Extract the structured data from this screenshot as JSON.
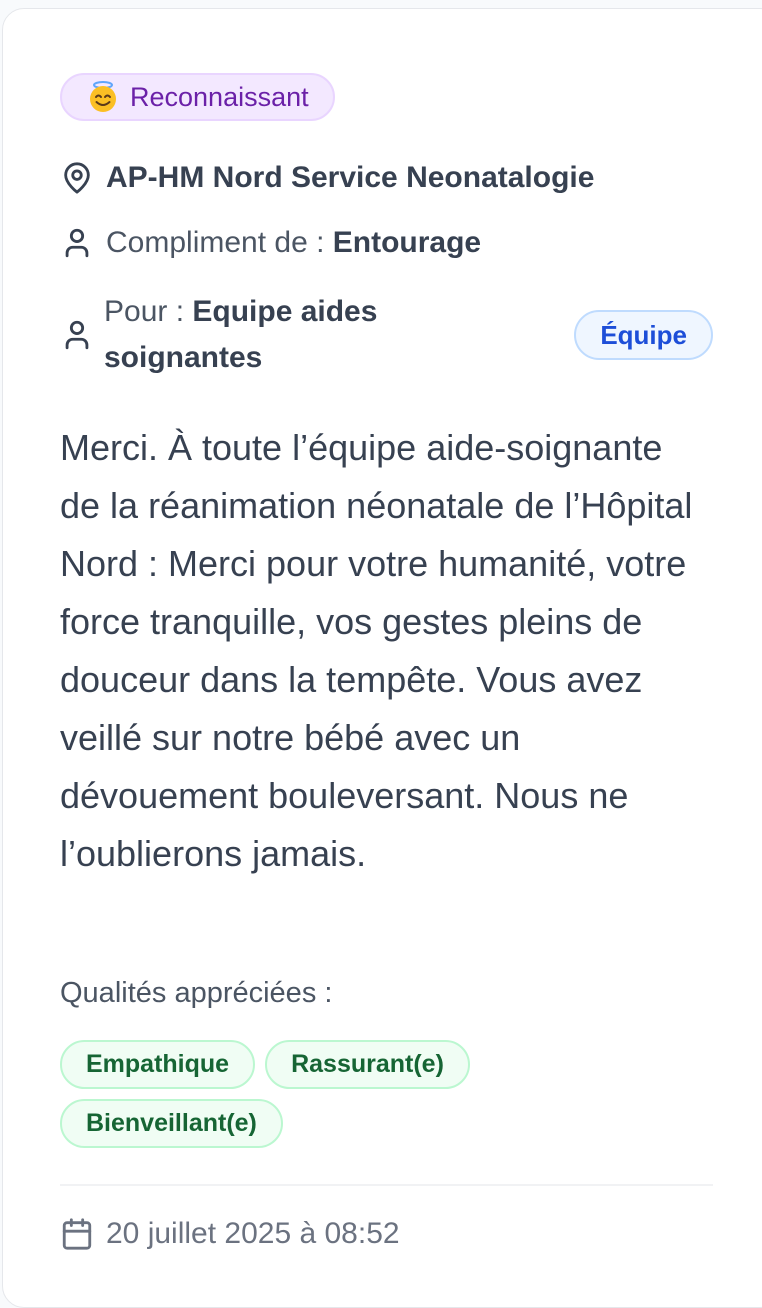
{
  "mood": {
    "emoji_icon": "smiling-face-with-halo-icon",
    "label": "Reconnaissant"
  },
  "location": {
    "icon": "map-pin-icon",
    "name": "AP-HM Nord Service Neonatalogie"
  },
  "from": {
    "icon": "user-icon",
    "prefix": "Compliment de : ",
    "value": "Entourage"
  },
  "recipient": {
    "icon": "user-icon",
    "prefix": "Pour : ",
    "value": "Equipe aides soignantes",
    "badge": "Équipe"
  },
  "message": "Merci. À toute l’équipe aide-soignante de la réanimation néonatale de l’Hôpital Nord : Merci pour votre humanité, votre force tranquille, vos gestes pleins de douceur dans la tempête. Vous avez veillé sur notre bébé avec un dévouement bouleversant. Nous ne l’oublierons jamais.",
  "qualities": {
    "label": "Qualités appréciées :",
    "tags": [
      "Empathique",
      "Rassurant(e)",
      "Bienveillant(e)"
    ]
  },
  "date": {
    "icon": "calendar-icon",
    "value": "20 juillet 2025 à 08:52"
  },
  "colors": {
    "mood_bg": "#f3e8ff",
    "mood_text": "#6b21a8",
    "team_bg": "#eff6ff",
    "team_text": "#1d4ed8",
    "tag_bg": "#f0fdf4",
    "tag_text": "#166534"
  }
}
